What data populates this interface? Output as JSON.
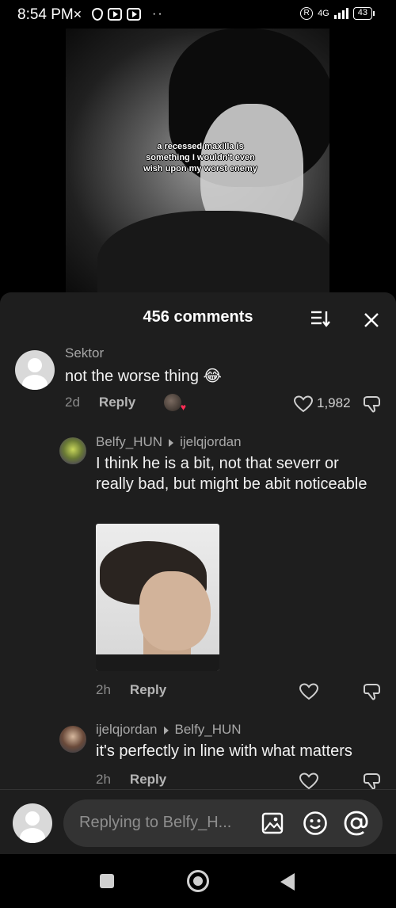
{
  "status_bar": {
    "time": "8:54 PM",
    "network": "4G",
    "battery": "43"
  },
  "video": {
    "caption": "a recessed maxilla is something I wouldn't even wish upon my worst enemy"
  },
  "comments_panel": {
    "count_label": "456 comments",
    "comments": [
      {
        "author": "Sektor",
        "text": "not the worse thing 😂",
        "age": "2d",
        "reply_label": "Reply",
        "likes": "1,982"
      },
      {
        "author": "Belfy_HUN",
        "reply_to": "ijelqjordan",
        "text": "I think he is a bit, not that severr or really bad, but might be abit noticeable",
        "age": "2h",
        "reply_label": "Reply"
      },
      {
        "author": "ijelqjordan",
        "reply_to": "Belfy_HUN",
        "text": "it's perfectly in line with what matters",
        "age": "2h",
        "reply_label": "Reply"
      }
    ]
  },
  "input_bar": {
    "placeholder": "Replying to Belfy_H..."
  },
  "icons": {
    "sort": "sort-icon",
    "close": "close-icon",
    "like": "heart-icon",
    "dislike": "dislike-icon",
    "image": "image-icon",
    "emoji": "emoji-icon",
    "mention": "at-icon"
  }
}
